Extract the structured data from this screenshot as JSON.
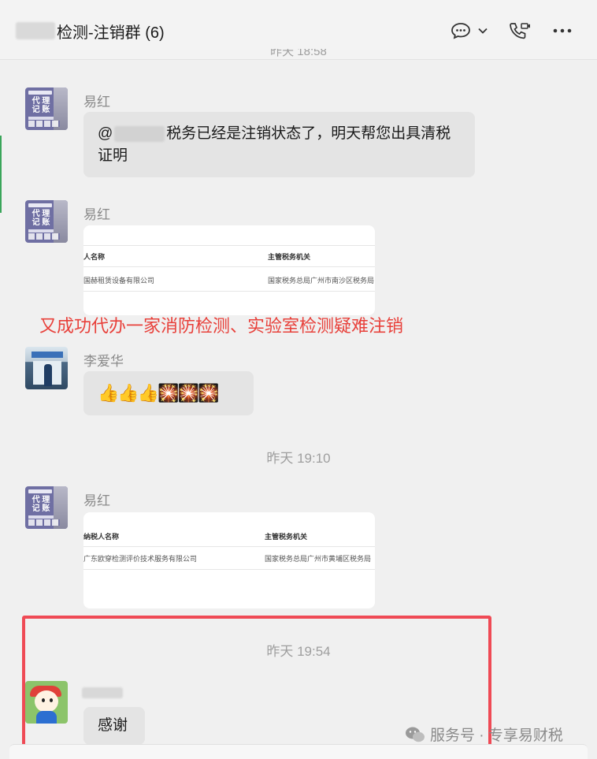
{
  "header": {
    "title": "检测-注销群 (6)",
    "icons": [
      "chat-bubble-icon",
      "chevron-down-icon",
      "video-call-icon",
      "more-icon"
    ]
  },
  "messages": {
    "m1": {
      "sender": "易红",
      "text_before": "@",
      "text_after": "税务已经是注销状态了，明天帮您出具清税证明",
      "avatar_text": "代理\n记账"
    },
    "m2": {
      "sender": "易红",
      "card": {
        "col1_header": "人名称",
        "col2_header": "主管税务机关",
        "col1_value": "国赫租赁设备有限公司",
        "col2_value": "国家税务总局广州市南沙区税务局"
      }
    },
    "m3": {
      "sender": "李爱华",
      "emoji": "👍👍👍🎇🎇🎇"
    },
    "m4": {
      "sender": "易红",
      "card": {
        "col1_header": "纳税人名称",
        "col2_header": "主管税务机关",
        "col1_value": "广东欧穿检测评价技术服务有限公司",
        "col2_value": "国家税务总局广州市黄埔区税务局"
      }
    },
    "m5": {
      "text": "感谢"
    }
  },
  "timestamps": {
    "top_partial": "昨天 18:58",
    "t1": "昨天 19:10",
    "t2": "昨天 19:54"
  },
  "overlay_caption": "又成功代办一家消防检测、实验室检测疑难注销",
  "watermark": {
    "text": "服务号 · 专享易财税"
  },
  "colors": {
    "overlay_red": "#e8403a",
    "highlight_border": "#ef4a55",
    "bubble_bg": "#e4e4e4"
  }
}
